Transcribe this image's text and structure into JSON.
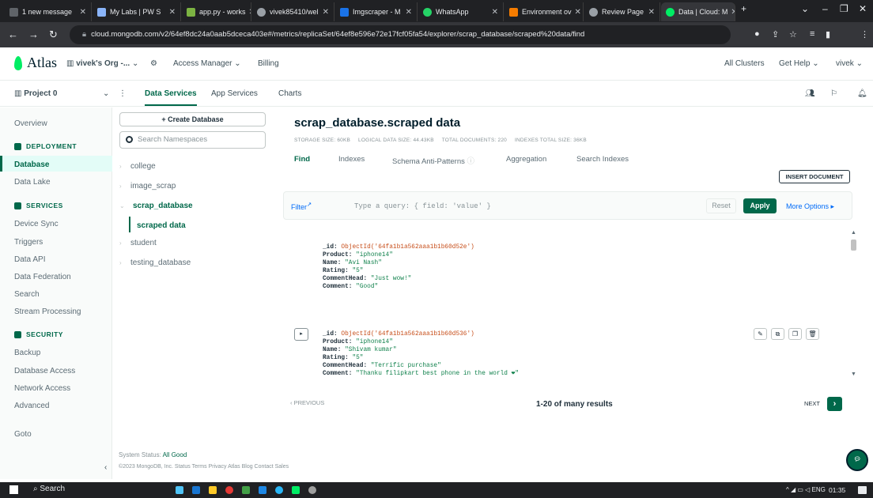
{
  "browser": {
    "tabs": [
      {
        "label": "1 new message"
      },
      {
        "label": "My Labs | PW S"
      },
      {
        "label": "app.py - works"
      },
      {
        "label": "vivek85410/wel"
      },
      {
        "label": "Imgscraper - M"
      },
      {
        "label": "WhatsApp"
      },
      {
        "label": "Environment ov"
      },
      {
        "label": "Review Page"
      },
      {
        "label": "Data | Cloud: M"
      }
    ],
    "new_tab": "+",
    "url": "cloud.mongodb.com/v2/64ef8dc24a0aab5dceca403e#/metrics/replicaSet/64ef8e596e72e17fcf05fa54/explorer/scrap_database/scraped%20data/find"
  },
  "topnav": {
    "logo": "Atlas",
    "org": "vivek's Org -...",
    "access_manager": "Access Manager",
    "billing": "Billing",
    "all_clusters": "All Clusters",
    "get_help": "Get Help",
    "user": "vivek"
  },
  "projnav": {
    "project": "Project 0",
    "tabs": [
      {
        "label": "Data Services"
      },
      {
        "label": "App Services"
      },
      {
        "label": "Charts"
      }
    ]
  },
  "sidebar": {
    "overview": "Overview",
    "deployment_head": "DEPLOYMENT",
    "database": "Database",
    "data_lake": "Data Lake",
    "services_head": "SERVICES",
    "device_sync": "Device Sync",
    "triggers": "Triggers",
    "data_api": "Data API",
    "data_federation": "Data Federation",
    "search": "Search",
    "stream_processing": "Stream Processing",
    "security_head": "SECURITY",
    "backup": "Backup",
    "database_access": "Database Access",
    "network_access": "Network Access",
    "advanced": "Advanced",
    "goto": "Goto"
  },
  "namespaces": {
    "create_label": "+ Create Database",
    "search_placeholder": "Search Namespaces",
    "databases": [
      {
        "label": "college"
      },
      {
        "label": "image_scrap"
      },
      {
        "label": "scrap_database"
      },
      {
        "label": "scraped data"
      },
      {
        "label": "student"
      },
      {
        "label": "testing_database"
      }
    ]
  },
  "collection": {
    "title": "scrap_database.scraped data",
    "storage_size": "STORAGE SIZE: 60KB",
    "logical_size": "LOGICAL DATA SIZE: 44.43KB",
    "total_docs": "TOTAL DOCUMENTS: 220",
    "indexes_size": "INDEXES TOTAL SIZE: 36KB",
    "tabs": [
      {
        "label": "Find"
      },
      {
        "label": "Indexes"
      },
      {
        "label": "Schema Anti-Patterns"
      },
      {
        "label": "Aggregation"
      },
      {
        "label": "Search Indexes"
      }
    ],
    "insert_doc": "INSERT DOCUMENT"
  },
  "filter": {
    "label": "Filter",
    "placeholder": "Type a query: { field: 'value' }",
    "reset": "Reset",
    "apply": "Apply",
    "more_options": "More Options ▸"
  },
  "documents": [
    {
      "id_key": "_id:",
      "id_val": "ObjectId('64fa1b1a562aaa1b1b60d52e')",
      "fields": [
        {
          "k": "Product:",
          "v": "\"iphone14\""
        },
        {
          "k": "Name:",
          "v": "\"Avi Nash\""
        },
        {
          "k": "Rating:",
          "v": "\"5\""
        },
        {
          "k": "CommentHead:",
          "v": "\"Just wow!\""
        },
        {
          "k": "Comment:",
          "v": "\"Good\""
        }
      ]
    },
    {
      "id_key": "_id:",
      "id_val": "ObjectId('64fa1b1a562aaa1b1b60d536')",
      "fields": [
        {
          "k": "Product:",
          "v": "\"iphone14\""
        },
        {
          "k": "Name:",
          "v": "\"Shivam  kumar\""
        },
        {
          "k": "Rating:",
          "v": "\"5\""
        },
        {
          "k": "CommentHead:",
          "v": "\"Terrific purchase\""
        },
        {
          "k": "Comment:",
          "v": "\"Thanku filipkart best phone in the world ❤\""
        }
      ]
    }
  ],
  "pager": {
    "prev": "PREVIOUS",
    "info": "1-20 of many results",
    "next": "NEXT"
  },
  "footer": {
    "status_label": "System Status:",
    "status_value": "All Good",
    "links": "©2023 MongoDB, Inc.   Status   Terms   Privacy   Atlas Blog   Contact Sales"
  },
  "taskbar": {
    "search": "Search",
    "lang": "ENG",
    "time": "01:35"
  },
  "colors": {
    "accent": "#00684a",
    "brand_leaf": "#00ed64",
    "link": "#016bf8"
  }
}
